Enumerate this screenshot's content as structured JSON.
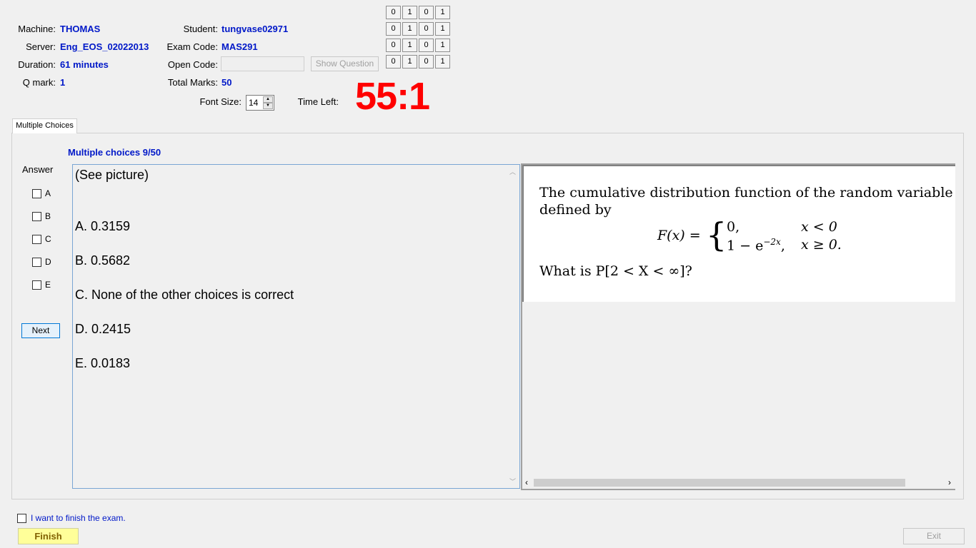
{
  "header": {
    "machine_label": "Machine:",
    "machine_value": "THOMAS",
    "server_label": "Server:",
    "server_value": "Eng_EOS_02022013",
    "duration_label": "Duration:",
    "duration_value": "61 minutes",
    "qmark_label": "Q mark:",
    "qmark_value": "1",
    "student_label": "Student:",
    "student_value": "tungvase02971",
    "exam_code_label": "Exam Code:",
    "exam_code_value": "MAS291",
    "open_code_label": "Open Code:",
    "open_code_value": "",
    "total_marks_label": "Total Marks:",
    "total_marks_value": "50",
    "show_question_label": "Show Question",
    "font_size_label": "Font Size:",
    "font_size_value": "14",
    "time_left_label": "Time Left:",
    "time_left_value": "55:1"
  },
  "bit_rows": [
    [
      "0",
      "1",
      "0",
      "1"
    ],
    [
      "0",
      "1",
      "0",
      "1"
    ],
    [
      "0",
      "1",
      "0",
      "1"
    ],
    [
      "0",
      "1",
      "0",
      "1"
    ]
  ],
  "tab": {
    "label": "Multiple Choices"
  },
  "question": {
    "counter": "Multiple choices 9/50",
    "answer_label": "Answer",
    "options": [
      "A",
      "B",
      "C",
      "D",
      "E"
    ],
    "next_label": "Next",
    "prompt": "(See picture)",
    "choices": [
      "A.  0.3159",
      "B.  0.5682",
      "C.  None of the other choices is correct",
      "D.  0.2415",
      "E.  0.0183"
    ]
  },
  "picture": {
    "line1": "The cumulative distribution function of the random variable X",
    "line2": "defined by",
    "fx_left": "F(x) =",
    "case1_expr": "0,",
    "case1_cond": "x < 0",
    "case2_expr_base": "1 − e",
    "case2_expr_exp": "−2x",
    "case2_expr_tail": ",",
    "case2_cond": "x ≥ 0.",
    "question_line": "What is P[2 < X < ∞]?"
  },
  "footer": {
    "finish_check_label": "I want to finish the exam.",
    "finish_label": "Finish",
    "exit_label": "Exit"
  }
}
